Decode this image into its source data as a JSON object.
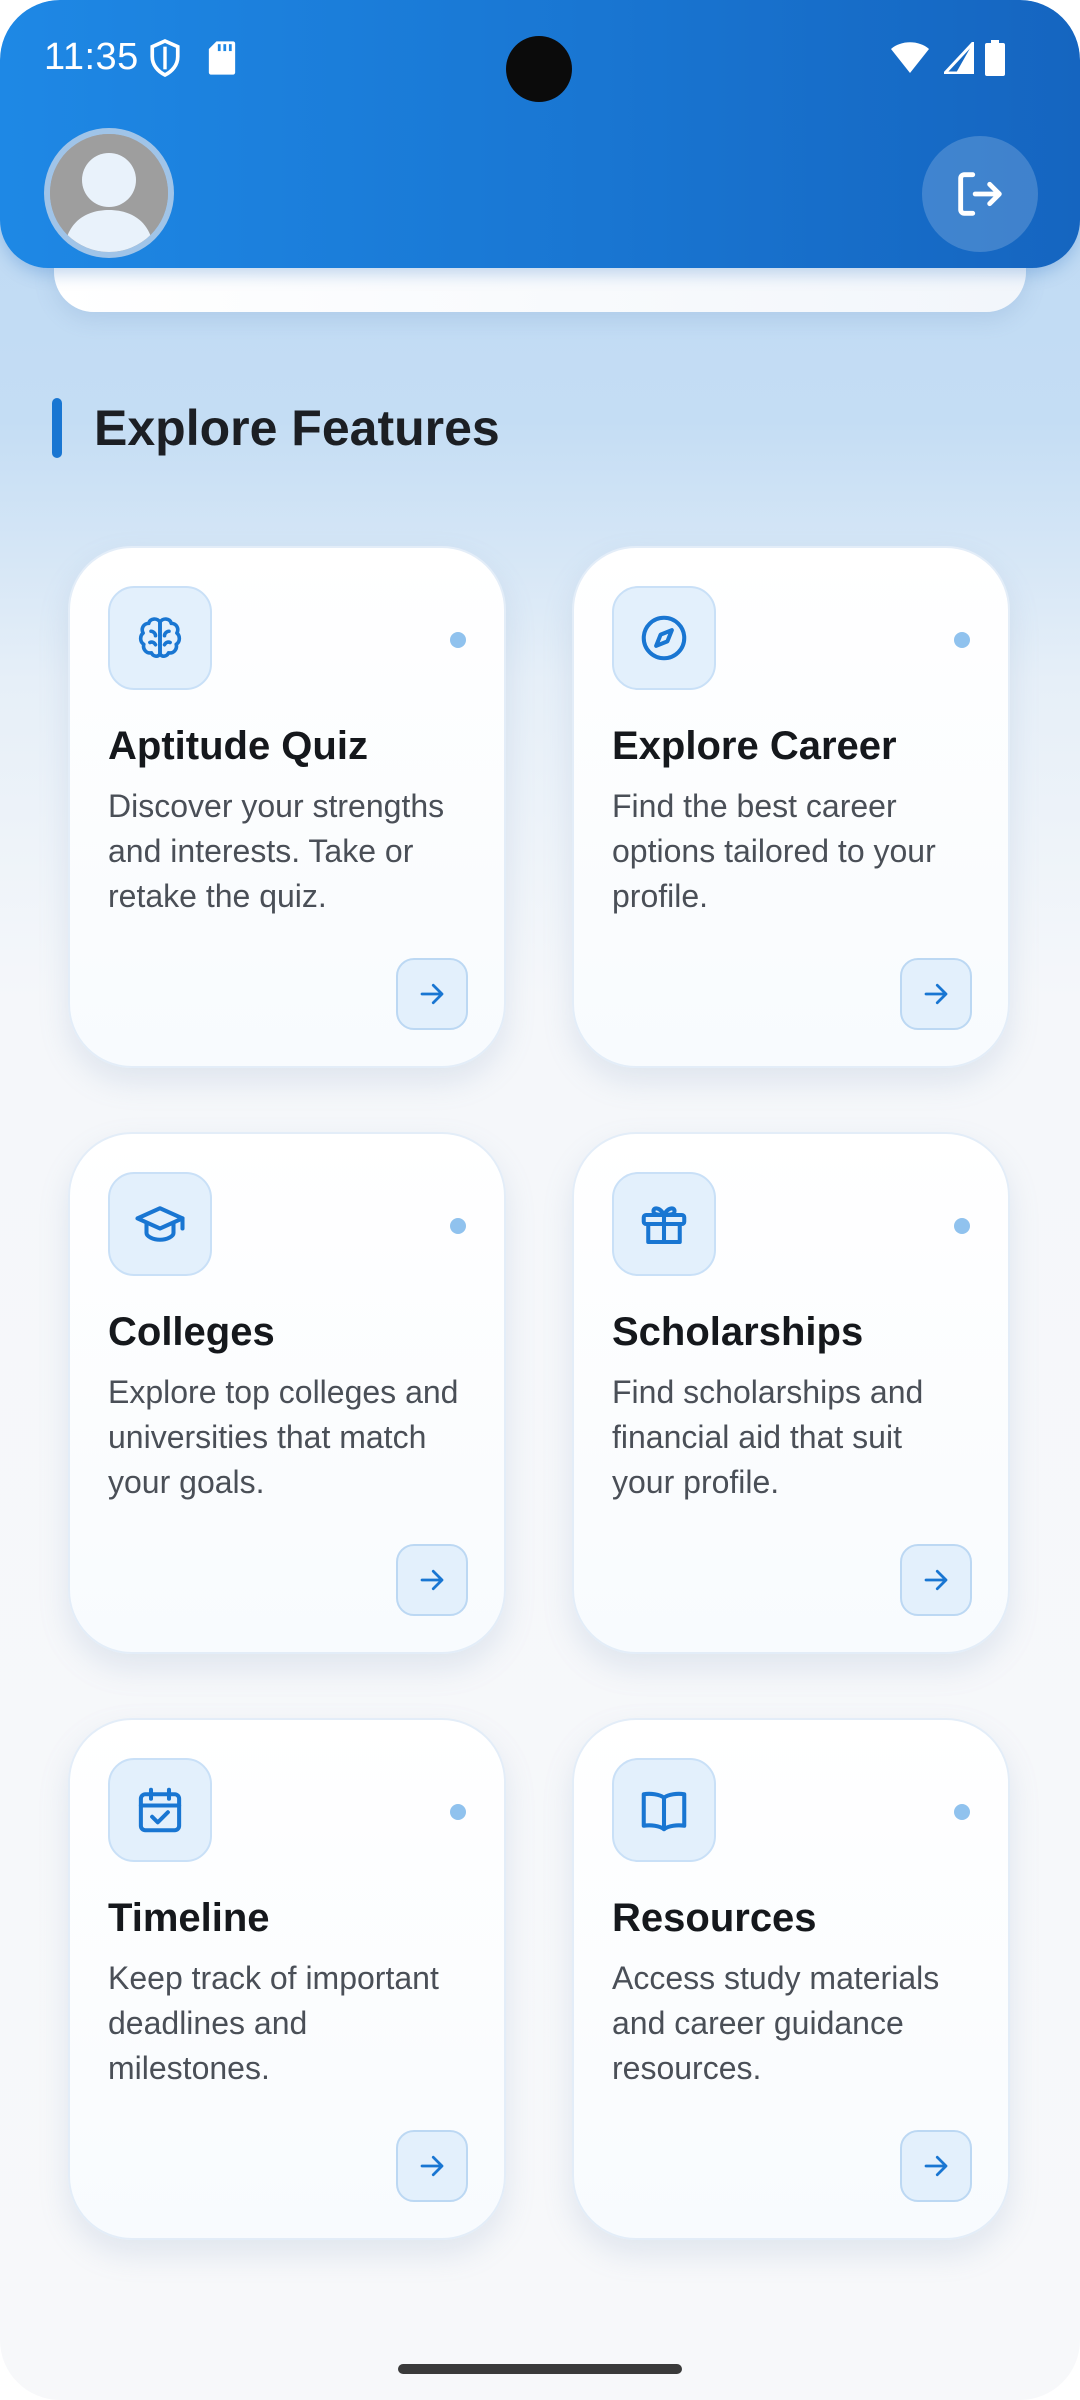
{
  "status_bar": {
    "time": "11:35"
  },
  "header": {
    "avatar_icon": "person-avatar",
    "logout_icon": "logout-icon"
  },
  "section": {
    "title": "Explore Features"
  },
  "features": [
    {
      "title": "Aptitude Quiz",
      "description": "Discover your strengths and interests. Take or retake the quiz.",
      "icon": "brain-icon"
    },
    {
      "title": "Explore Career",
      "description": "Find the best career options tailored to your profile.",
      "icon": "compass-icon"
    },
    {
      "title": "Colleges",
      "description": "Explore top colleges and universities that match your goals.",
      "icon": "graduation-cap-icon"
    },
    {
      "title": "Scholarships",
      "description": "Find scholarships and financial aid that suit your profile.",
      "icon": "gift-icon"
    },
    {
      "title": "Timeline",
      "description": "Keep track of important deadlines and milestones.",
      "icon": "calendar-check-icon"
    },
    {
      "title": "Resources",
      "description": "Access study materials and career guidance resources.",
      "icon": "book-open-icon"
    }
  ],
  "colors": {
    "primary": "#1976d2",
    "accent_light": "#e3f0fc"
  }
}
